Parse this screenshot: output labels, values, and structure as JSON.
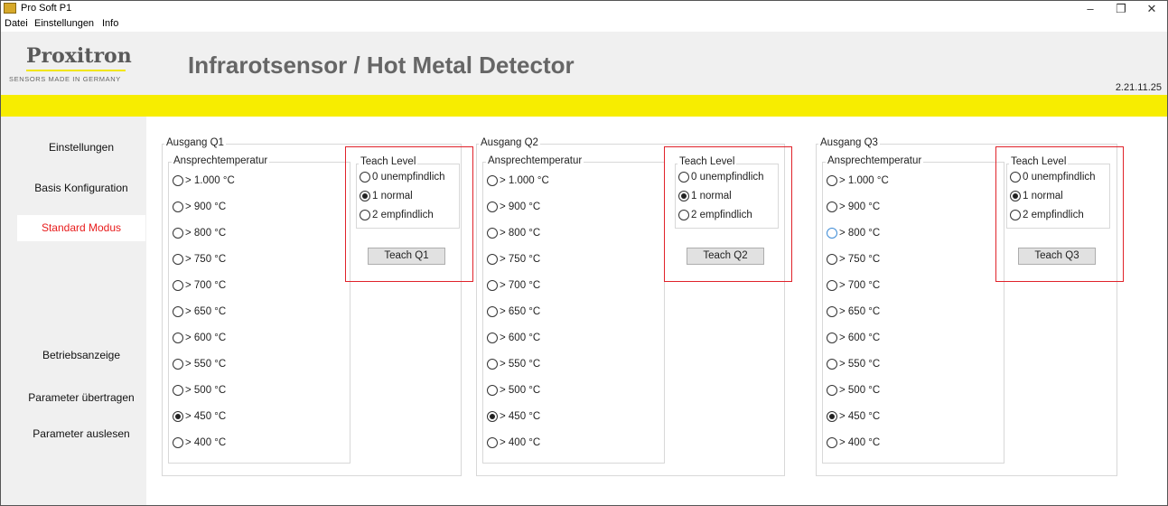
{
  "window": {
    "title": "Pro Soft P1",
    "controls": [
      "–",
      "❐",
      "✕"
    ]
  },
  "menu": [
    "Datei",
    "Einstellungen",
    "Info"
  ],
  "header": {
    "logo": "Proxitron",
    "logo_tagline": "SENSORS MADE IN GERMANY",
    "title": "Infrarotsensor / Hot Metal Detector",
    "version": "2.21.11.25"
  },
  "colors": {
    "accent_yellow": "#f7ed00",
    "active_red": "#e81c1c",
    "highlight_box": "#e0222a"
  },
  "nav": {
    "items": [
      "Einstellungen",
      "Basis Konfiguration",
      "Standard Modus",
      "Betriebsanzeige",
      "Parameter übertragen",
      "Parameter auslesen"
    ],
    "active": "Standard Modus"
  },
  "outputs": [
    {
      "label": "Ausgang Q1",
      "temp_label": "Ansprechtemperatur",
      "temps": [
        "> 1.000 °C",
        "> 900 °C",
        "> 800 °C",
        "> 750 °C",
        "> 700 °C",
        "> 650 °C",
        "> 600 °C",
        "> 550 °C",
        "> 500 °C",
        "> 450 °C",
        "> 400 °C"
      ],
      "temp_selected": "> 450 °C",
      "teach_label": "Teach Level",
      "teach_levels": [
        "0 unempfindlich",
        "1 normal",
        "2 empfindlich"
      ],
      "teach_selected": "1 normal",
      "button": "Teach Q1"
    },
    {
      "label": "Ausgang Q2",
      "temp_label": "Ansprechtemperatur",
      "temps": [
        "> 1.000 °C",
        "> 900 °C",
        "> 800 °C",
        "> 750 °C",
        "> 700 °C",
        "> 650 °C",
        "> 600 °C",
        "> 550 °C",
        "> 500 °C",
        "> 450 °C",
        "> 400 °C"
      ],
      "temp_selected": "> 450 °C",
      "teach_label": "Teach Level",
      "teach_levels": [
        "0 unempfindlich",
        "1 normal",
        "2 empfindlich"
      ],
      "teach_selected": "1 normal",
      "button": "Teach Q2"
    },
    {
      "label": "Ausgang Q3",
      "temp_label": "Ansprechtemperatur",
      "temps": [
        "> 1.000 °C",
        "> 900 °C",
        "> 800 °C",
        "> 750 °C",
        "> 700 °C",
        "> 650 °C",
        "> 600 °C",
        "> 550 °C",
        "> 500 °C",
        "> 450 °C",
        "> 400 °C"
      ],
      "temp_selected": "> 450 °C",
      "teach_label": "Teach Level",
      "teach_levels": [
        "0 unempfindlich",
        "1 normal",
        "2 empfindlich"
      ],
      "teach_selected": "1 normal",
      "button": "Teach Q3"
    }
  ]
}
